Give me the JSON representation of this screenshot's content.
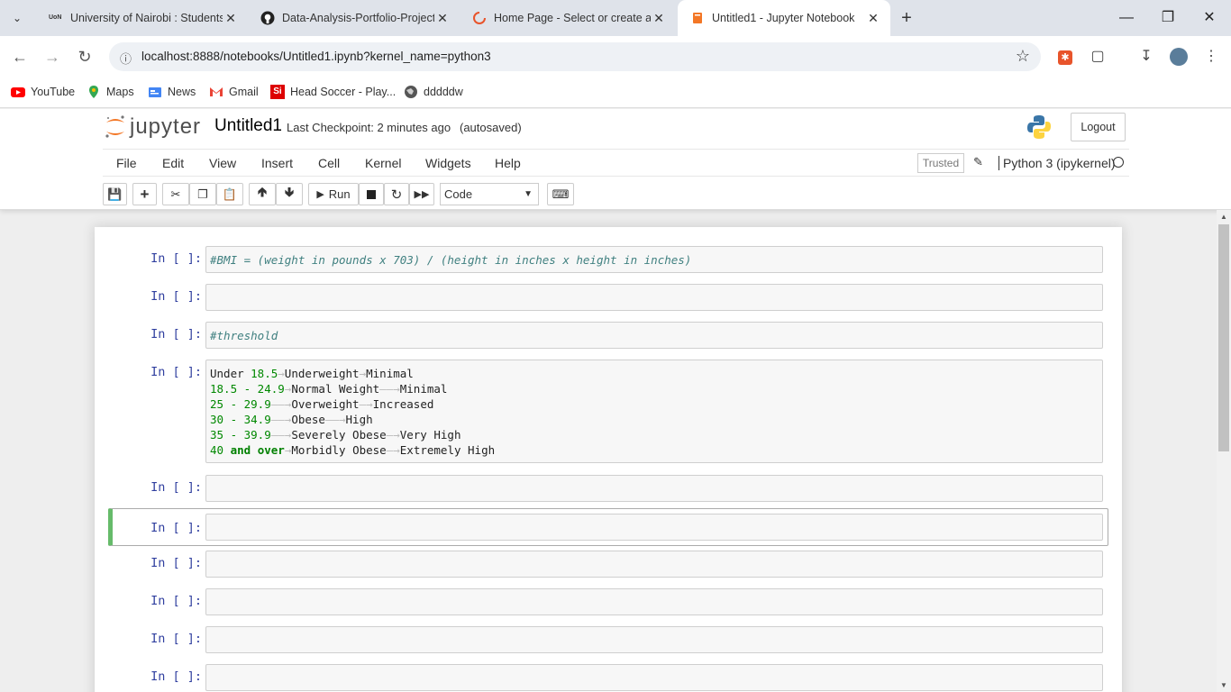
{
  "browser": {
    "tabs": [
      {
        "title": "University of Nairobi : Students",
        "favicon": "uon-icon"
      },
      {
        "title": "Data-Analysis-Portfolio-Projects",
        "favicon": "github-icon"
      },
      {
        "title": "Home Page - Select or create a",
        "favicon": "loading-spinner-icon"
      },
      {
        "title": "Untitled1 - Jupyter Notebook",
        "favicon": "jupyter-book-icon"
      }
    ],
    "address": "localhost:8888/notebooks/Untitled1.ipynb?kernel_name=python3",
    "bookmarks": [
      {
        "label": "YouTube"
      },
      {
        "label": "Maps"
      },
      {
        "label": "News"
      },
      {
        "label": "Gmail"
      },
      {
        "label": "Head Soccer - Play..."
      },
      {
        "label": "dddddw"
      }
    ]
  },
  "jupyter": {
    "logo_text": "jupyter",
    "notebook_name": "Untitled1",
    "checkpoint": "Last Checkpoint: 2 minutes ago",
    "autosave": "(autosaved)",
    "logout": "Logout",
    "menu": [
      "File",
      "Edit",
      "View",
      "Insert",
      "Cell",
      "Kernel",
      "Widgets",
      "Help"
    ],
    "trusted": "Trusted",
    "kernel": "Python 3 (ipykernel)",
    "run_label": "Run",
    "cell_type": "Code"
  },
  "cells": [
    {
      "prompt": "In [ ]:",
      "code": "#BMI = (weight in pounds x 703) / (height in inches x height in inches)"
    },
    {
      "prompt": "In [ ]:",
      "code": ""
    },
    {
      "prompt": "In [ ]:",
      "code": "#threshold"
    },
    {
      "prompt": "In [ ]:",
      "code_lines": [
        [
          "Under ",
          "18.5",
          "Underweight",
          "Minimal"
        ],
        [
          "",
          "18.5 - 24.9",
          "Normal Weight",
          "Minimal"
        ],
        [
          "",
          "25 - 29.9",
          "Overweight",
          "Increased"
        ],
        [
          "",
          "30 - 34.9",
          "Obese",
          "High"
        ],
        [
          "",
          "35 - 39.9",
          "Severely Obese",
          "Very High"
        ],
        [
          "",
          "40",
          "and over",
          "Morbidly Obese",
          "Extremely High"
        ]
      ]
    },
    {
      "prompt": "In [ ]:",
      "code": ""
    },
    {
      "prompt": "In [ ]:",
      "code": ""
    },
    {
      "prompt": "In [ ]:",
      "code": ""
    },
    {
      "prompt": "In [ ]:",
      "code": ""
    },
    {
      "prompt": "In [ ]:",
      "code": ""
    },
    {
      "prompt": "In [ ]:",
      "code": ""
    }
  ]
}
